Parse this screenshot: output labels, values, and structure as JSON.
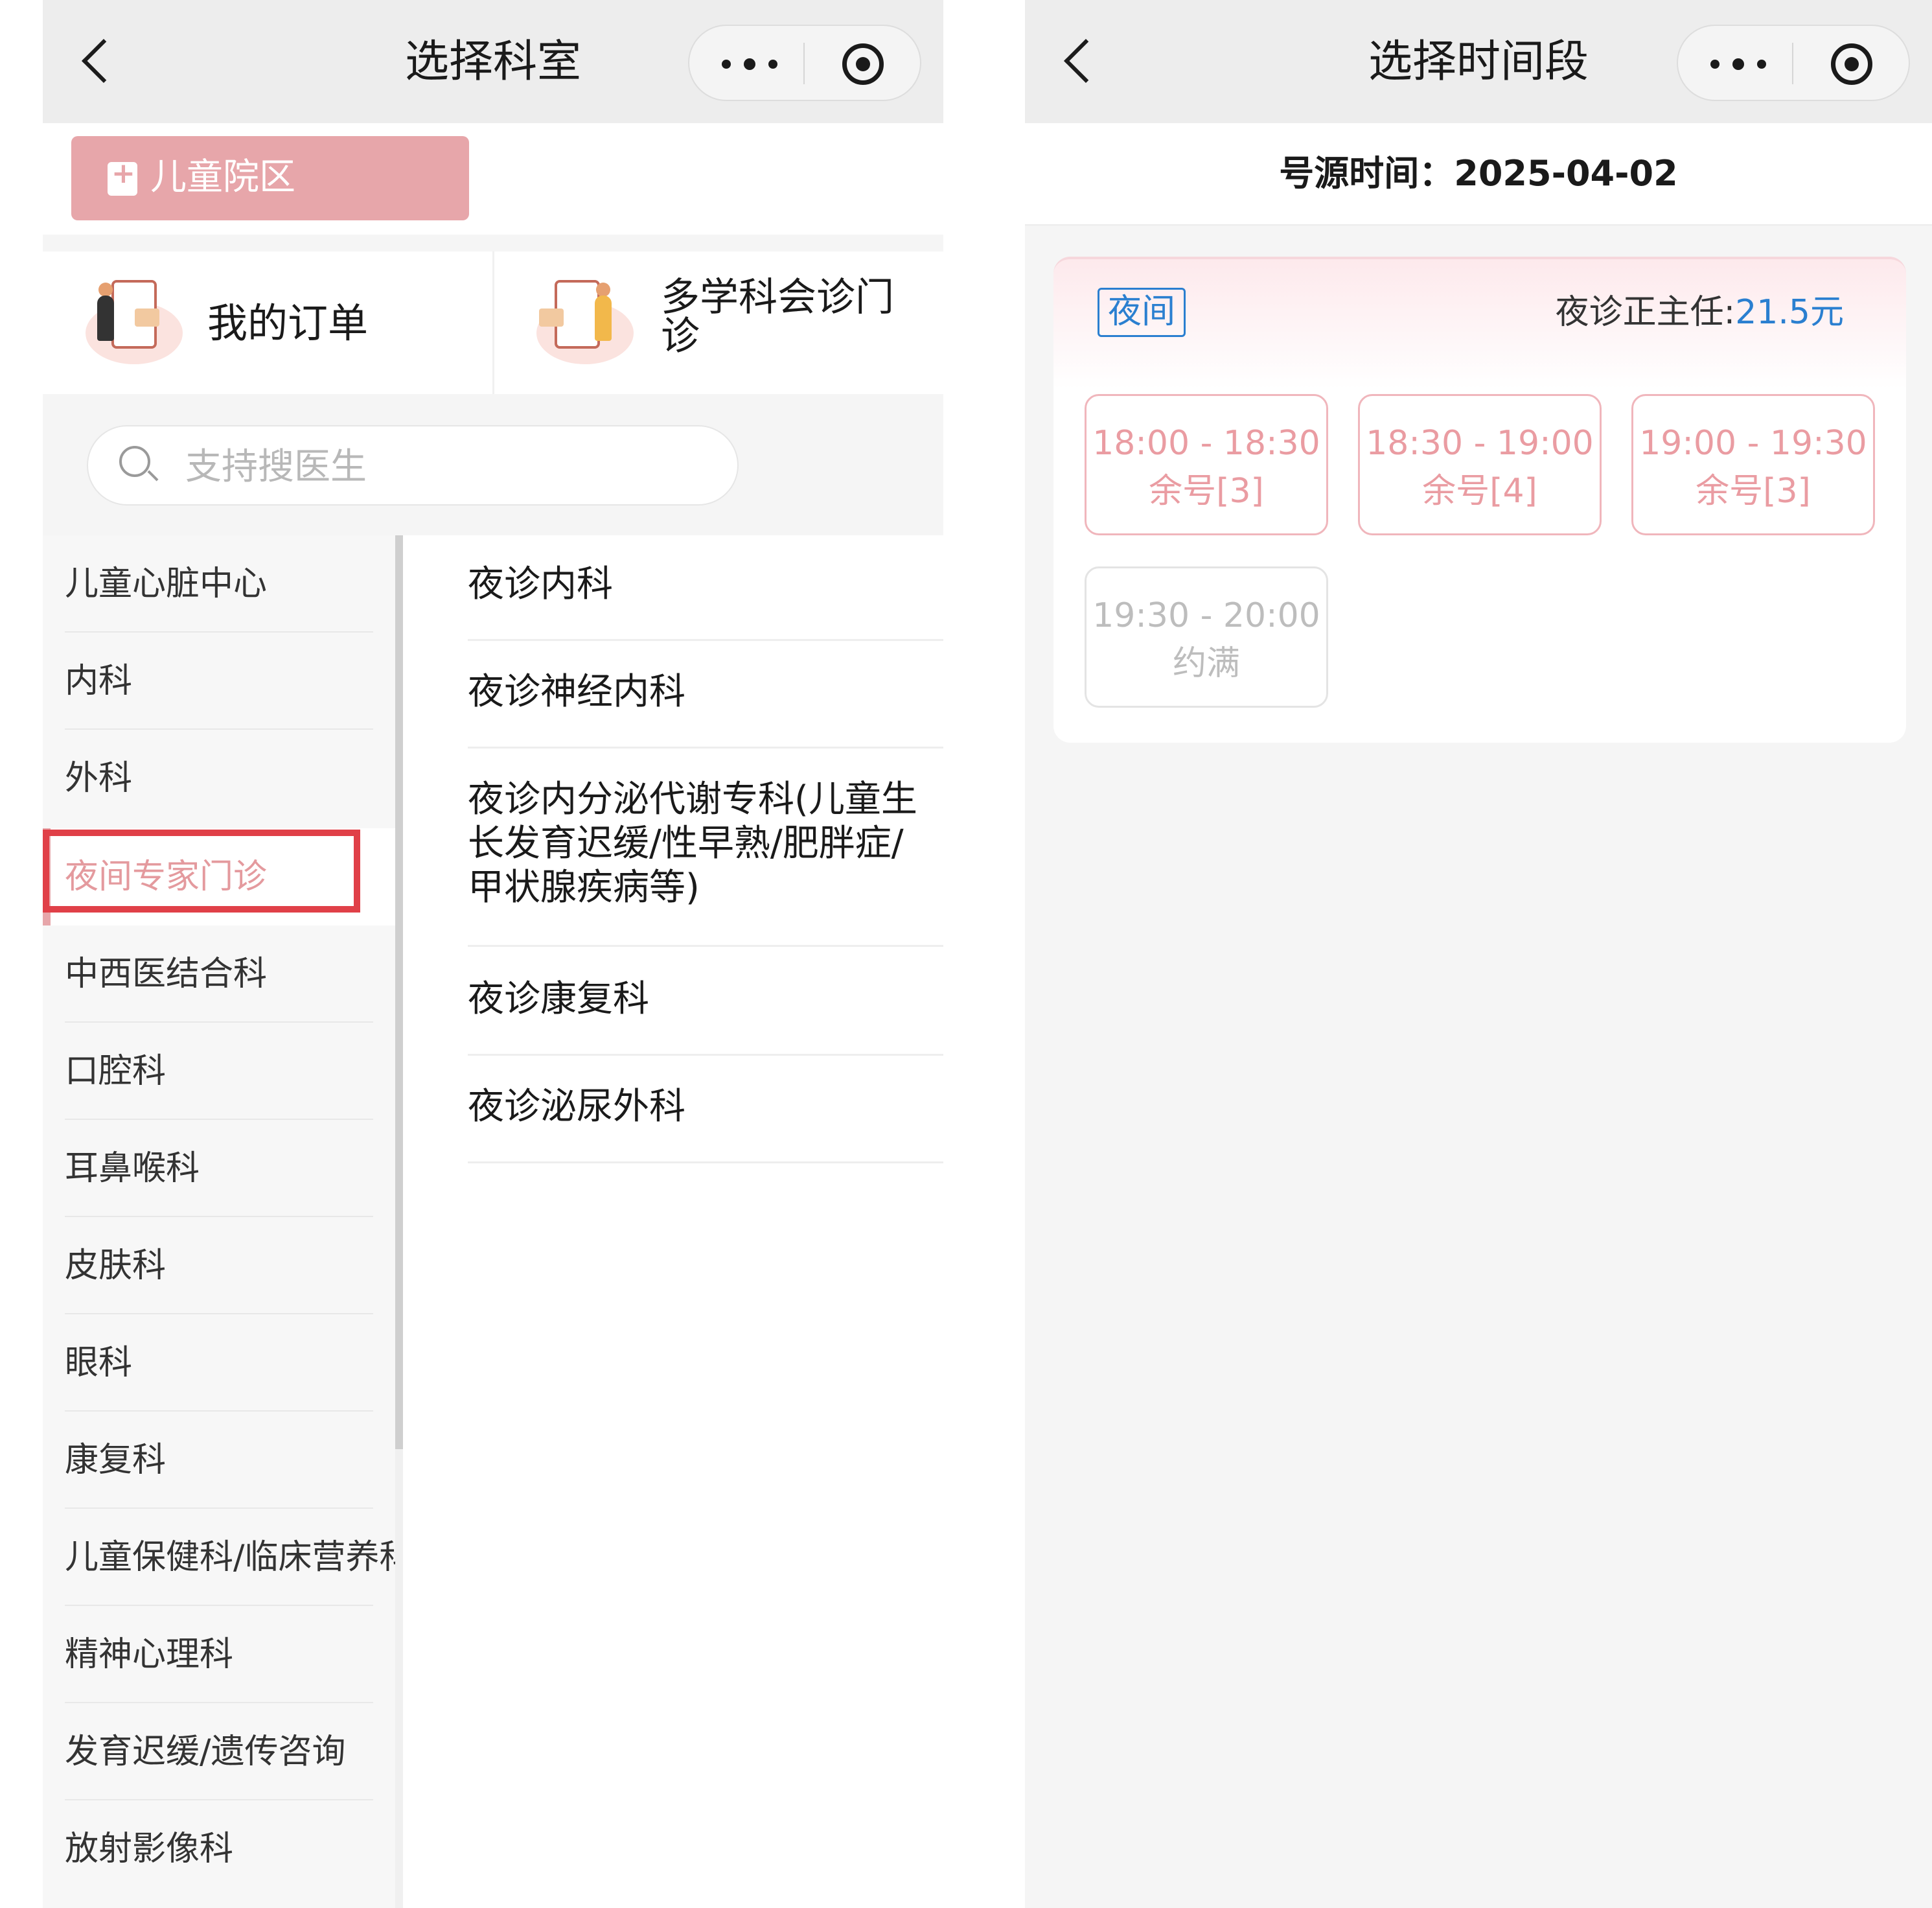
{
  "left": {
    "nav_title": "选择科室",
    "campus_label": "儿童院区",
    "quick_entries": [
      {
        "label": "我的订单"
      },
      {
        "label_line1": "多学科会诊门",
        "label_line2": "诊"
      }
    ],
    "search_placeholder": "支持搜医生",
    "departments": [
      "儿童心脏中心",
      "内科",
      "外科",
      "夜间专家门诊",
      "中西医结合科",
      "口腔科",
      "耳鼻喉科",
      "皮肤科",
      "眼科",
      "康复科",
      "儿童保健科/临床营养科",
      "精神心理科",
      "发育迟缓/遗传咨询",
      "放射影像科"
    ],
    "selected_department": "夜间专家门诊",
    "sub_departments": [
      {
        "line1": "夜诊内科"
      },
      {
        "line1": "夜诊神经内科"
      },
      {
        "line1": "夜诊内分泌代谢专科(儿童生",
        "line2": "长发育迟缓/性早熟/肥胖症/",
        "line3": "甲状腺疾病等)"
      },
      {
        "line1": "夜诊康复科"
      },
      {
        "line1": "夜诊泌尿外科"
      }
    ]
  },
  "right": {
    "nav_title": "选择时间段",
    "date_label": "号源时间：2025-04-02",
    "period_tag": "夜间",
    "fee_label": "夜诊正主任:",
    "fee_value": "21.5元",
    "slots": [
      {
        "time": "18:00 - 18:30",
        "status": "余号[3]",
        "available": true
      },
      {
        "time": "18:30 - 19:00",
        "status": "余号[4]",
        "available": true
      },
      {
        "time": "19:00 - 19:30",
        "status": "余号[3]",
        "available": true
      },
      {
        "time": "19:30 - 20:00",
        "status": "约满",
        "available": false
      }
    ]
  },
  "colors": {
    "accent_pink": "#e7a6aa",
    "highlight_red": "#e04048",
    "link_blue": "#2a7fd0",
    "slot_text": "#ea9ca2"
  },
  "icons": [
    "back-icon",
    "more-icon",
    "mini-program-close-icon",
    "hospital-icon",
    "order-illustration-icon",
    "consultation-illustration-icon",
    "search-icon",
    "chevron-right-icon"
  ]
}
